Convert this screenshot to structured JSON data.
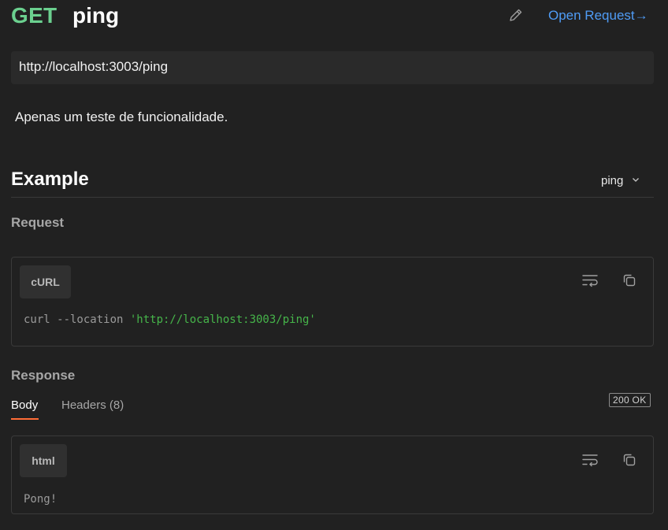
{
  "request": {
    "method": "GET",
    "name": "ping",
    "url": "http://localhost:3003/ping",
    "description": "Apenas um teste de funcionalidade."
  },
  "header": {
    "open_request_label": "Open Request→"
  },
  "example": {
    "title": "Example",
    "selected": "ping"
  },
  "request_section": {
    "label": "Request",
    "language": "cURL",
    "code_prefix": "curl --location ",
    "code_string": "'http://localhost:3003/ping'"
  },
  "response_section": {
    "label": "Response",
    "tabs": [
      {
        "label": "Body"
      },
      {
        "label": "Headers (8)"
      }
    ],
    "status": "200 OK",
    "language": "html",
    "body": "Pong!"
  },
  "colors": {
    "method_get": "#6bd08f",
    "link": "#4f9cf5",
    "active_tab": "#ff6c37",
    "string": "#46b54a",
    "background": "#212121"
  },
  "icons": [
    "pencil-icon",
    "chevron-down-icon",
    "wrap-lines-icon",
    "copy-icon"
  ]
}
